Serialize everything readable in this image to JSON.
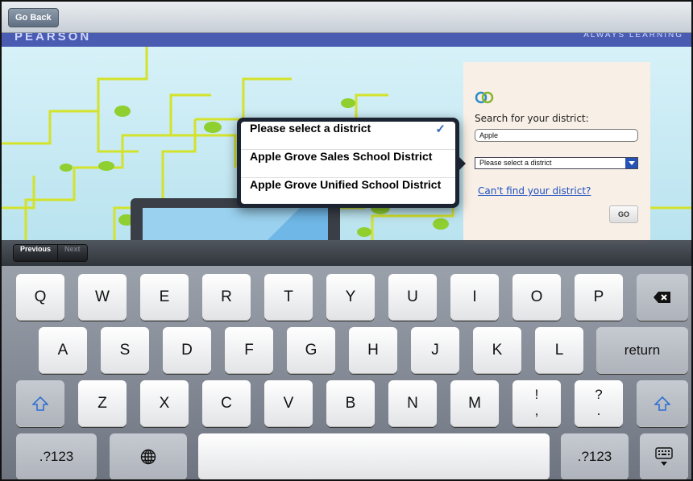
{
  "topbar": {
    "go_back_label": "Go Back"
  },
  "page_header": {
    "brand": "PEARSON",
    "tagline": "ALWAYS LEARNING"
  },
  "search_panel": {
    "label": "Search for your district:",
    "input_value": "Apple",
    "select_value": "Please select a district",
    "cant_find_link": "Can't find your district?",
    "go_label": "GO"
  },
  "popover": {
    "items": [
      {
        "label": "Please select a district",
        "selected": true
      },
      {
        "label": "Apple Grove Sales School District",
        "selected": false
      },
      {
        "label": "Apple Grove Unified School District",
        "selected": false
      }
    ],
    "check_glyph": "✓"
  },
  "accessory_bar": {
    "previous_label": "Previous",
    "next_label": "Next"
  },
  "keyboard": {
    "row1": [
      "Q",
      "W",
      "E",
      "R",
      "T",
      "Y",
      "U",
      "I",
      "O",
      "P"
    ],
    "backspace_icon": "delete-icon",
    "row2": [
      "A",
      "S",
      "D",
      "F",
      "G",
      "H",
      "J",
      "K",
      "L"
    ],
    "return_label": "return",
    "row3": [
      "Z",
      "X",
      "C",
      "V",
      "B",
      "N",
      "M"
    ],
    "punct1": {
      "top": "!",
      "bottom": ","
    },
    "punct2": {
      "top": "?",
      "bottom": "."
    },
    "numbers_label": ".?123",
    "globe_icon": "globe-icon",
    "hide_keyboard_icon": "keyboard-hide-icon",
    "shift_icon": "shift-icon"
  },
  "colors": {
    "header_blue": "#4a5cb2",
    "link_blue": "#1d4fc0",
    "popover_dark": "#1b2230"
  }
}
